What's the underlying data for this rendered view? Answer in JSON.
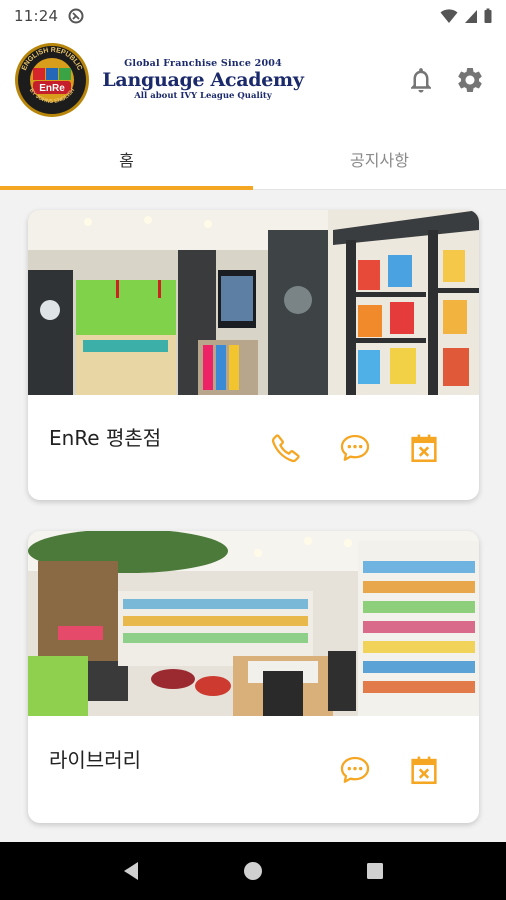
{
  "status": {
    "time": "11:24"
  },
  "brand": {
    "badge_top": "ENGLISH REPUBLIC",
    "badge_center": "EnRe",
    "badge_bottom": "BY JOHNS ENGLISH",
    "tagline_top": "Global Franchise Since 2004",
    "name": "Language Academy",
    "tagline_bottom": "All about IVY League Quality"
  },
  "tabs": [
    {
      "label": "홈",
      "active": true
    },
    {
      "label": "공지사항",
      "active": false
    }
  ],
  "cards": [
    {
      "title": "EnRe 평촌점",
      "actions": [
        "phone-icon",
        "chat-icon",
        "calendar-icon"
      ]
    },
    {
      "title": "라이브러리",
      "actions": [
        "chat-icon",
        "calendar-icon"
      ]
    }
  ],
  "colors": {
    "accent": "#f5a623",
    "brand_navy": "#1b2a6b",
    "icon_gray": "#757575"
  }
}
